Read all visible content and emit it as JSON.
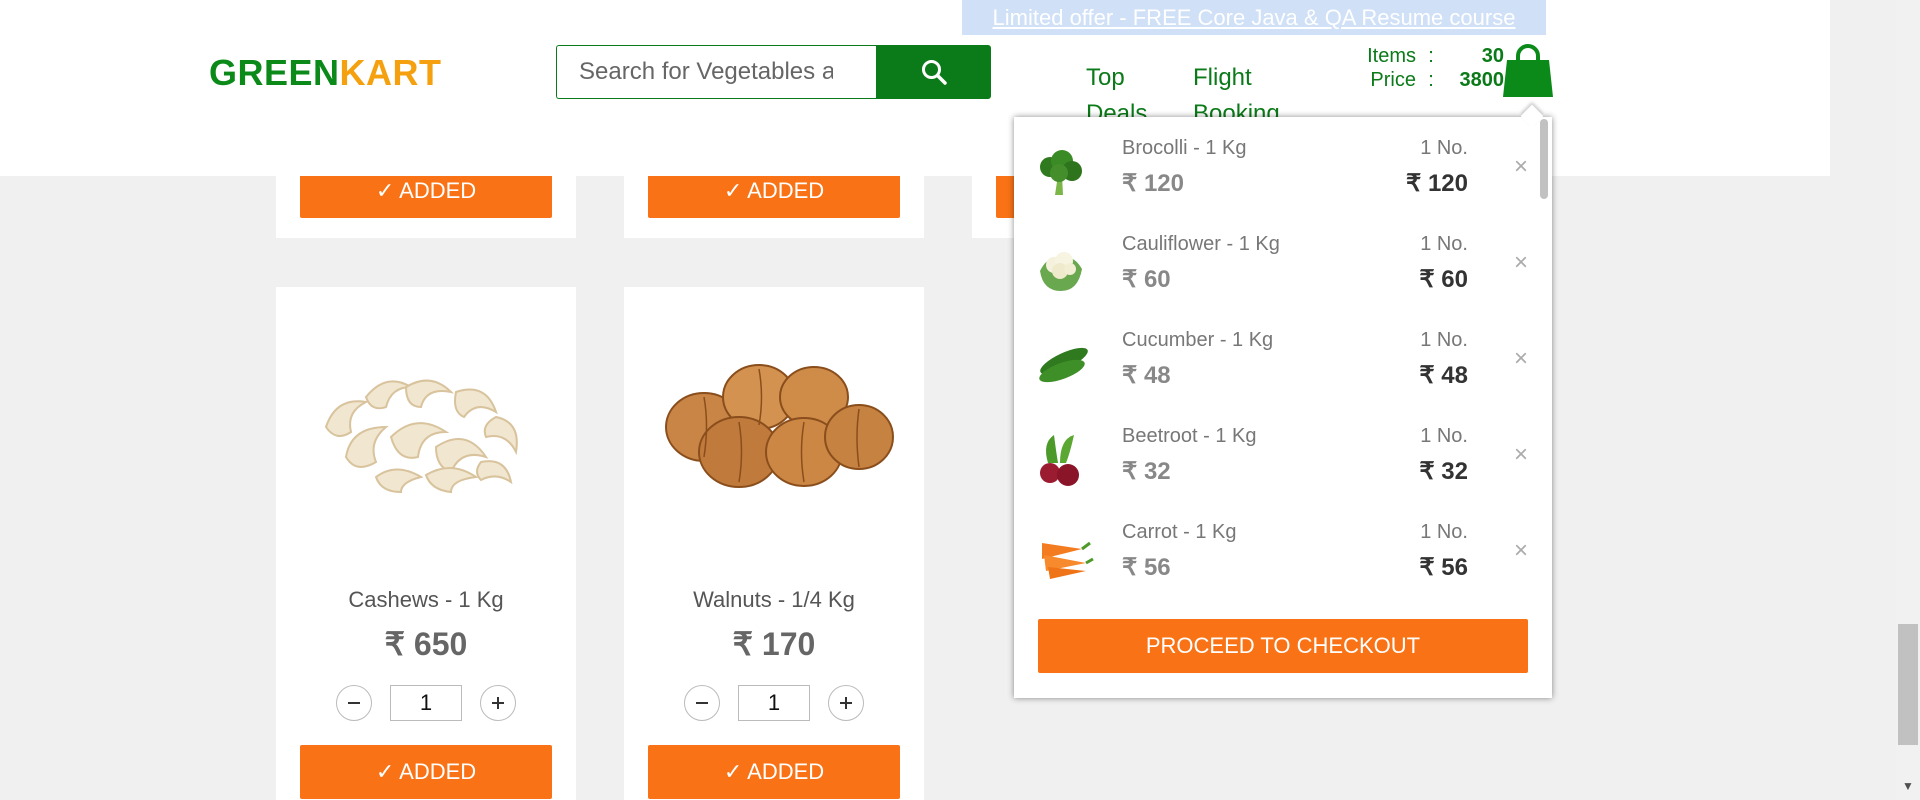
{
  "header": {
    "offer_text": "Limited offer - FREE Core Java & QA Resume course",
    "logo_green": "GREEN",
    "logo_kart": "KART",
    "search_placeholder": "Search for Vegetables and Fruits",
    "nav": [
      {
        "line1": "Top",
        "line2": "Deals"
      },
      {
        "line1": "Flight",
        "line2": "Booking"
      }
    ],
    "cart_info": {
      "items_label": "Items",
      "price_label": "Price",
      "separator": ":",
      "items_value": "30",
      "price_value": "3800"
    }
  },
  "products_top": {
    "added_label": "✓ ADDED"
  },
  "products": [
    {
      "name": "Cashews - 1 Kg",
      "price": "₹ 650",
      "qty": "1",
      "button": "✓ ADDED"
    },
    {
      "name": "Walnuts - 1/4 Kg",
      "price": "₹ 170",
      "qty": "1",
      "button": "✓ ADDED"
    }
  ],
  "cart_preview": {
    "items": [
      {
        "name": "Brocolli - 1 Kg",
        "price": "₹ 120",
        "qty": "1 No.",
        "amount": "₹ 120",
        "icon": "broccoli-icon"
      },
      {
        "name": "Cauliflower - 1 Kg",
        "price": "₹ 60",
        "qty": "1 No.",
        "amount": "₹ 60",
        "icon": "cauliflower-icon"
      },
      {
        "name": "Cucumber - 1 Kg",
        "price": "₹ 48",
        "qty": "1 No.",
        "amount": "₹ 48",
        "icon": "cucumber-icon"
      },
      {
        "name": "Beetroot - 1 Kg",
        "price": "₹ 32",
        "qty": "1 No.",
        "amount": "₹ 32",
        "icon": "beetroot-icon"
      },
      {
        "name": "Carrot - 1 Kg",
        "price": "₹ 56",
        "qty": "1 No.",
        "amount": "₹ 56",
        "icon": "carrot-icon"
      }
    ],
    "remove_symbol": "×",
    "checkout_label": "PROCEED TO CHECKOUT"
  },
  "colors": {
    "brand_green": "#0b7a18",
    "brand_orange": "#f97316",
    "logo_yellow": "#f5a10f"
  }
}
